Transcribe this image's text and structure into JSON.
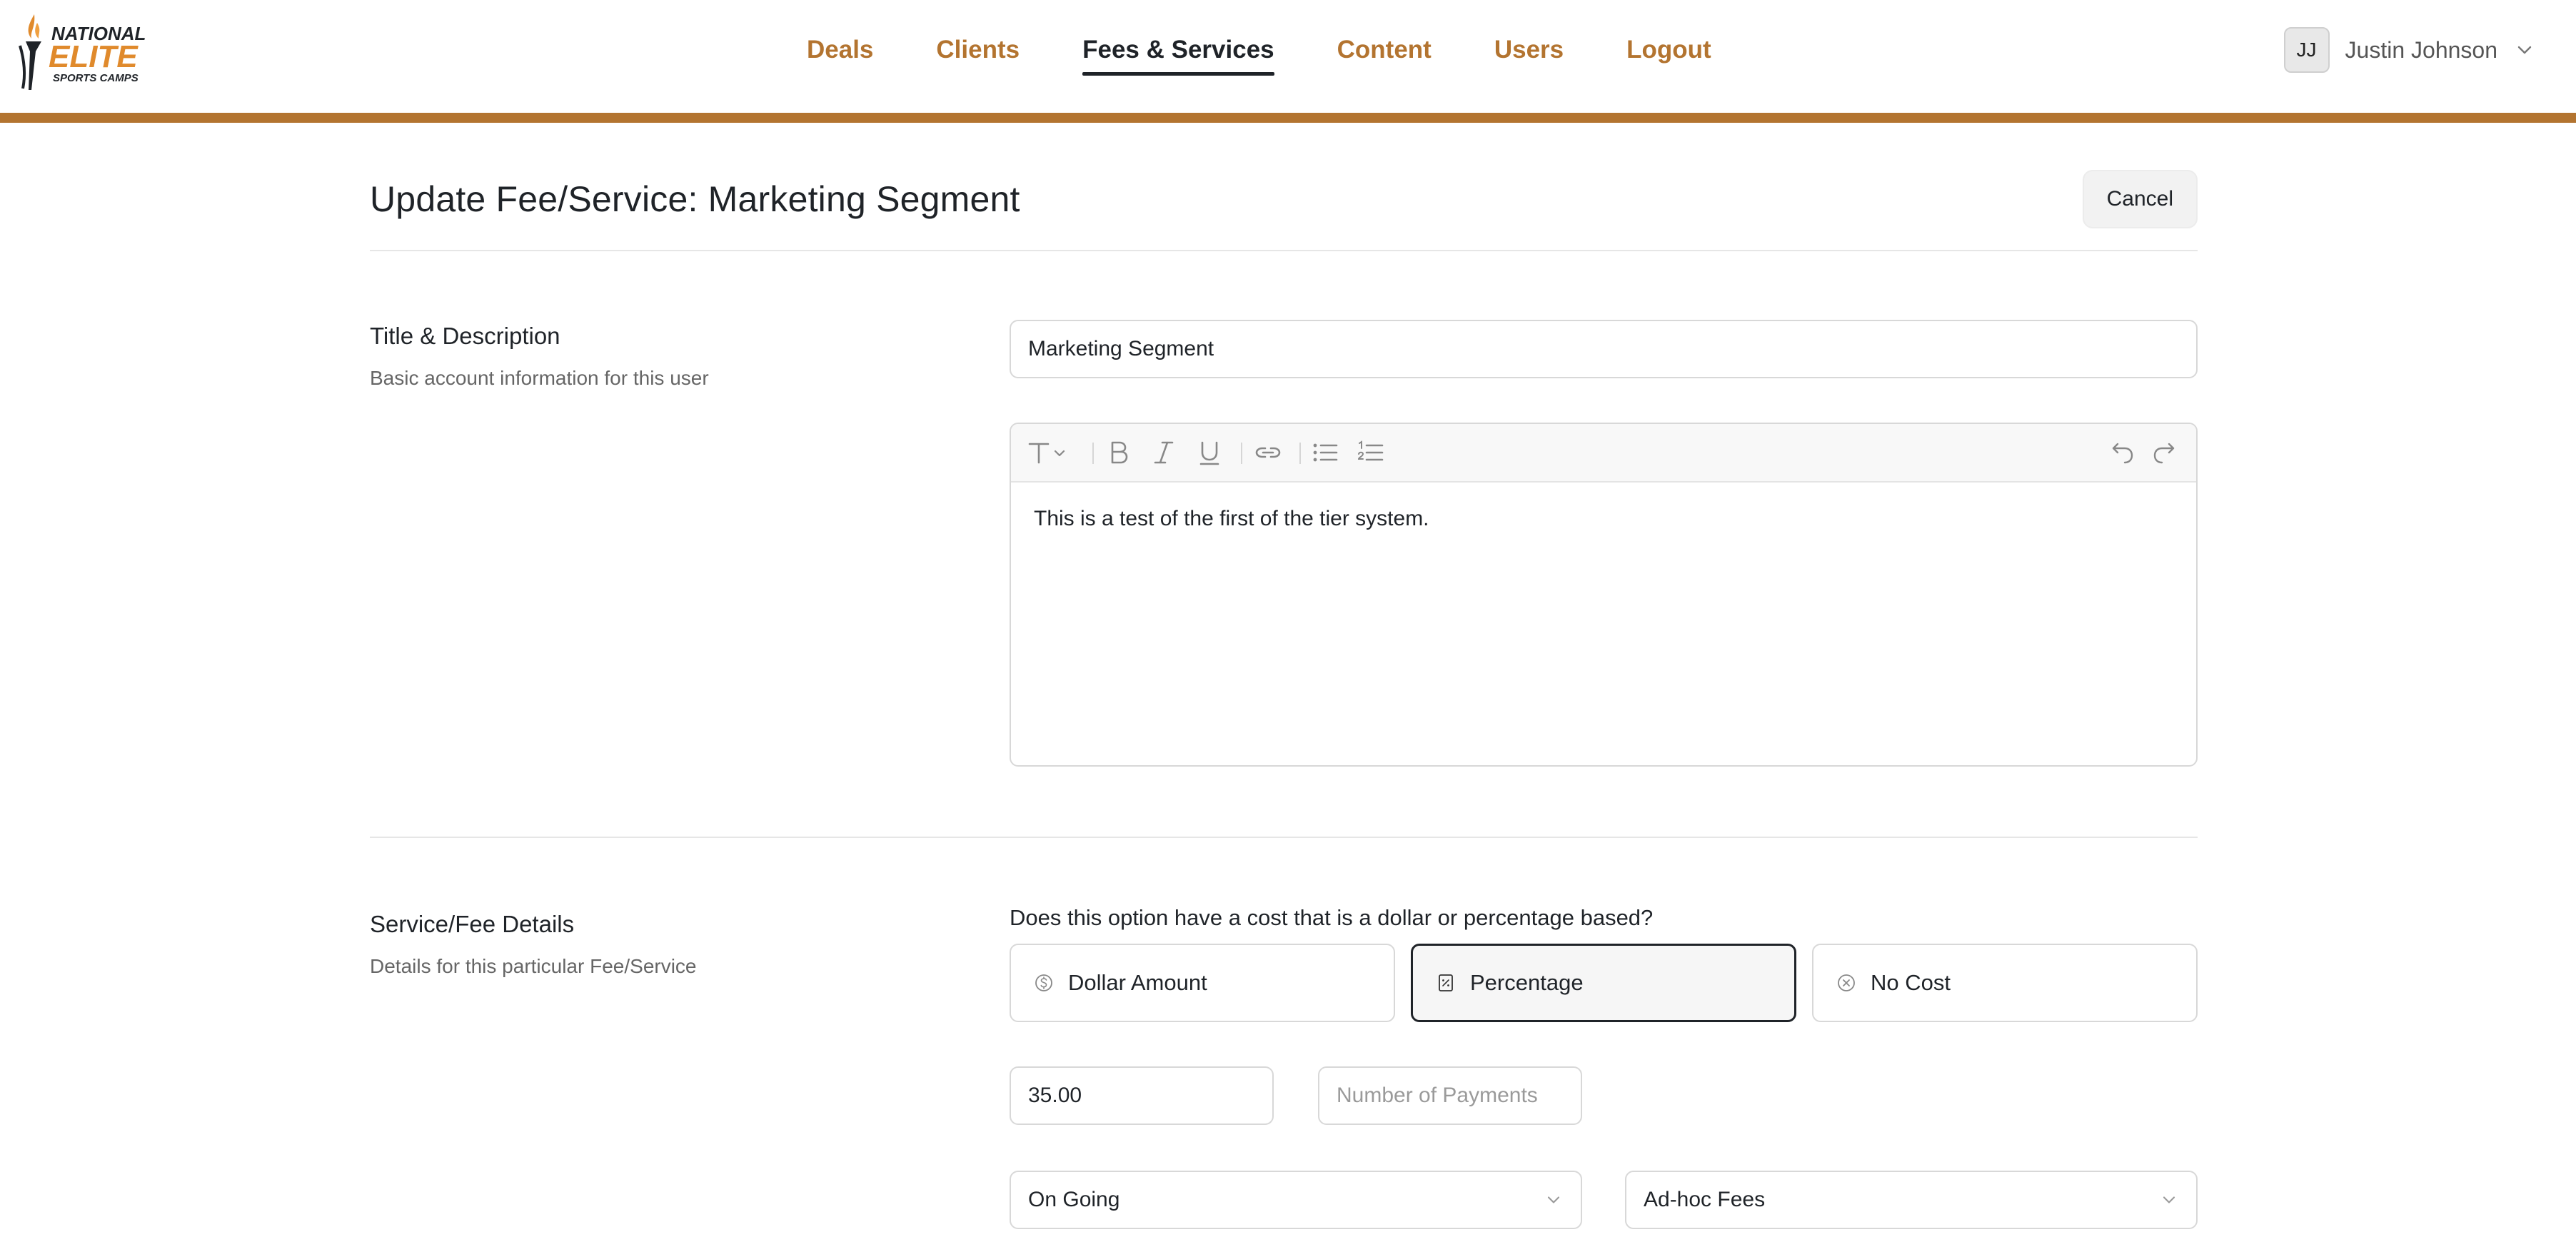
{
  "header": {
    "logo": {
      "line1": "NATIONAL",
      "line2": "ELITE",
      "line3": "SPORTS CAMPS"
    },
    "nav": [
      {
        "label": "Deals",
        "active": false
      },
      {
        "label": "Clients",
        "active": false
      },
      {
        "label": "Fees & Services",
        "active": true
      },
      {
        "label": "Content",
        "active": false
      },
      {
        "label": "Users",
        "active": false
      },
      {
        "label": "Logout",
        "active": false
      }
    ],
    "user": {
      "initials": "JJ",
      "name": "Justin Johnson",
      "menu_icon": "chevron-down-icon"
    }
  },
  "page": {
    "title": "Update Fee/Service: Marketing Segment",
    "cancel_label": "Cancel"
  },
  "title_section": {
    "label": "Title & Description",
    "sub": "Basic account information for this user",
    "title_value": "Marketing Segment",
    "editor": {
      "toolbar": [
        "text-style-icon",
        "bold-icon",
        "italic-icon",
        "underline-icon",
        "link-icon",
        "bullet-list-icon",
        "numbered-list-icon",
        "undo-icon",
        "redo-icon"
      ],
      "content": "This is a test of the first of the tier system."
    }
  },
  "details_section": {
    "label": "Service/Fee Details",
    "sub": "Details for this particular Fee/Service",
    "question": "Does this option have a cost that is a dollar or percentage based?",
    "options": [
      {
        "label": "Dollar Amount",
        "icon": "dollar-icon",
        "selected": false
      },
      {
        "label": "Percentage",
        "icon": "percent-icon",
        "selected": true
      },
      {
        "label": "No Cost",
        "icon": "no-cost-icon",
        "selected": false
      }
    ],
    "amount_value": "35.00",
    "payments_placeholder": "Number of Payments",
    "frequency_value": "On Going",
    "category_value": "Ad-hoc Fees"
  },
  "colors": {
    "accent": "#b37430",
    "text": "#1f2328",
    "border": "#d8d8d8"
  }
}
